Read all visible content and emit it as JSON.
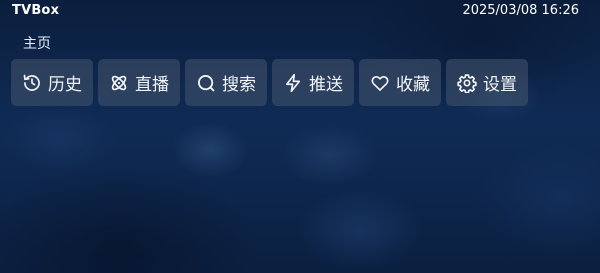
{
  "header": {
    "app_title": "TVBox",
    "datetime": "2025/03/08 16:26"
  },
  "breadcrumb": "主页",
  "menu": [
    {
      "label": "历史",
      "icon": "history-icon"
    },
    {
      "label": "直播",
      "icon": "live-atom-icon"
    },
    {
      "label": "搜索",
      "icon": "search-icon"
    },
    {
      "label": "推送",
      "icon": "lightning-icon"
    },
    {
      "label": "收藏",
      "icon": "heart-icon"
    },
    {
      "label": "设置",
      "icon": "gear-icon"
    }
  ],
  "colors": {
    "background": "#0c2347",
    "menu_item_bg": "#46556e",
    "text": "#ffffff"
  }
}
